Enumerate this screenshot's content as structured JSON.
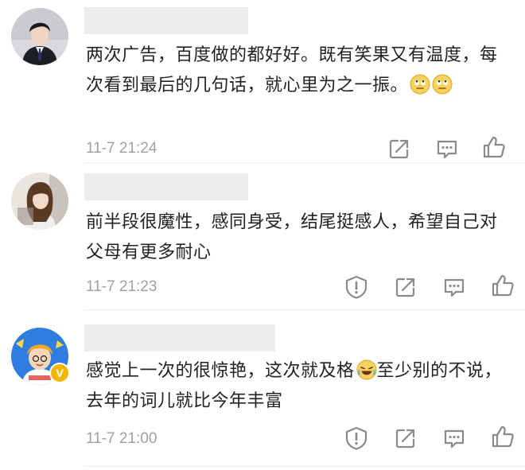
{
  "comments": [
    {
      "text": "两次广告，百度做的都好好。既有笑果又有温度，每次看到最后的几句话，就心里为之一振。",
      "emoji_after": "eye-roll-emoji",
      "time": "11-7 21:24",
      "avatar": "man-in-suit-avatar",
      "actions": [
        "share-icon",
        "comment-icon",
        "like-icon"
      ]
    },
    {
      "text": "前半段很魔性，感同身受，结尾挺感人，希望自己对父母有更多耐心",
      "time": "11-7 21:23",
      "avatar": "woman-portrait-avatar",
      "actions": [
        "report-icon",
        "share-icon",
        "comment-icon",
        "like-icon"
      ]
    },
    {
      "text_before_emoji": "感觉上一次的很惊艳，这次就及格",
      "emoji_inline": "laugh-cry-emoji",
      "text_after_emoji": "至少别的不说，去年的词儿就比今年丰富",
      "time": "11-7 21:00",
      "avatar": "cartoon-boy-avatar",
      "verified_badge": "V",
      "actions": [
        "report-icon",
        "share-icon",
        "comment-icon",
        "like-icon"
      ]
    }
  ],
  "colors": {
    "text": "#222222",
    "time": "#a0a0a0",
    "icon": "#8a8a8a",
    "name_placeholder": "#ececec",
    "badge": "#f5b400"
  }
}
